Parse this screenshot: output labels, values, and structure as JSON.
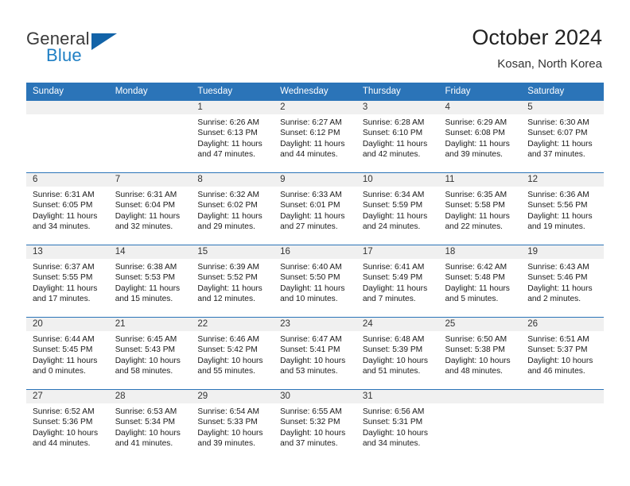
{
  "brand": {
    "word_one": "General",
    "word_two": "Blue",
    "logo_icon": "triangle-logo-icon",
    "accent_color": "#1263a8",
    "blue_text_color": "#1f7fc4"
  },
  "header": {
    "title": "October 2024",
    "subtitle": "Kosan, North Korea"
  },
  "theme": {
    "header_row_bg": "#2b74b8",
    "daynum_bg": "#f0f0f0",
    "row_separator": "#2b74b8"
  },
  "weekday_headers": [
    "Sunday",
    "Monday",
    "Tuesday",
    "Wednesday",
    "Thursday",
    "Friday",
    "Saturday"
  ],
  "weeks": [
    [
      {
        "day": "",
        "blank": true,
        "sunrise": "",
        "sunset": "",
        "daylight_1": "",
        "daylight_2": ""
      },
      {
        "day": "",
        "blank": true,
        "sunrise": "",
        "sunset": "",
        "daylight_1": "",
        "daylight_2": ""
      },
      {
        "day": "1",
        "blank": false,
        "sunrise": "Sunrise: 6:26 AM",
        "sunset": "Sunset: 6:13 PM",
        "daylight_1": "Daylight: 11 hours",
        "daylight_2": "and 47 minutes."
      },
      {
        "day": "2",
        "blank": false,
        "sunrise": "Sunrise: 6:27 AM",
        "sunset": "Sunset: 6:12 PM",
        "daylight_1": "Daylight: 11 hours",
        "daylight_2": "and 44 minutes."
      },
      {
        "day": "3",
        "blank": false,
        "sunrise": "Sunrise: 6:28 AM",
        "sunset": "Sunset: 6:10 PM",
        "daylight_1": "Daylight: 11 hours",
        "daylight_2": "and 42 minutes."
      },
      {
        "day": "4",
        "blank": false,
        "sunrise": "Sunrise: 6:29 AM",
        "sunset": "Sunset: 6:08 PM",
        "daylight_1": "Daylight: 11 hours",
        "daylight_2": "and 39 minutes."
      },
      {
        "day": "5",
        "blank": false,
        "sunrise": "Sunrise: 6:30 AM",
        "sunset": "Sunset: 6:07 PM",
        "daylight_1": "Daylight: 11 hours",
        "daylight_2": "and 37 minutes."
      }
    ],
    [
      {
        "day": "6",
        "blank": false,
        "sunrise": "Sunrise: 6:31 AM",
        "sunset": "Sunset: 6:05 PM",
        "daylight_1": "Daylight: 11 hours",
        "daylight_2": "and 34 minutes."
      },
      {
        "day": "7",
        "blank": false,
        "sunrise": "Sunrise: 6:31 AM",
        "sunset": "Sunset: 6:04 PM",
        "daylight_1": "Daylight: 11 hours",
        "daylight_2": "and 32 minutes."
      },
      {
        "day": "8",
        "blank": false,
        "sunrise": "Sunrise: 6:32 AM",
        "sunset": "Sunset: 6:02 PM",
        "daylight_1": "Daylight: 11 hours",
        "daylight_2": "and 29 minutes."
      },
      {
        "day": "9",
        "blank": false,
        "sunrise": "Sunrise: 6:33 AM",
        "sunset": "Sunset: 6:01 PM",
        "daylight_1": "Daylight: 11 hours",
        "daylight_2": "and 27 minutes."
      },
      {
        "day": "10",
        "blank": false,
        "sunrise": "Sunrise: 6:34 AM",
        "sunset": "Sunset: 5:59 PM",
        "daylight_1": "Daylight: 11 hours",
        "daylight_2": "and 24 minutes."
      },
      {
        "day": "11",
        "blank": false,
        "sunrise": "Sunrise: 6:35 AM",
        "sunset": "Sunset: 5:58 PM",
        "daylight_1": "Daylight: 11 hours",
        "daylight_2": "and 22 minutes."
      },
      {
        "day": "12",
        "blank": false,
        "sunrise": "Sunrise: 6:36 AM",
        "sunset": "Sunset: 5:56 PM",
        "daylight_1": "Daylight: 11 hours",
        "daylight_2": "and 19 minutes."
      }
    ],
    [
      {
        "day": "13",
        "blank": false,
        "sunrise": "Sunrise: 6:37 AM",
        "sunset": "Sunset: 5:55 PM",
        "daylight_1": "Daylight: 11 hours",
        "daylight_2": "and 17 minutes."
      },
      {
        "day": "14",
        "blank": false,
        "sunrise": "Sunrise: 6:38 AM",
        "sunset": "Sunset: 5:53 PM",
        "daylight_1": "Daylight: 11 hours",
        "daylight_2": "and 15 minutes."
      },
      {
        "day": "15",
        "blank": false,
        "sunrise": "Sunrise: 6:39 AM",
        "sunset": "Sunset: 5:52 PM",
        "daylight_1": "Daylight: 11 hours",
        "daylight_2": "and 12 minutes."
      },
      {
        "day": "16",
        "blank": false,
        "sunrise": "Sunrise: 6:40 AM",
        "sunset": "Sunset: 5:50 PM",
        "daylight_1": "Daylight: 11 hours",
        "daylight_2": "and 10 minutes."
      },
      {
        "day": "17",
        "blank": false,
        "sunrise": "Sunrise: 6:41 AM",
        "sunset": "Sunset: 5:49 PM",
        "daylight_1": "Daylight: 11 hours",
        "daylight_2": "and 7 minutes."
      },
      {
        "day": "18",
        "blank": false,
        "sunrise": "Sunrise: 6:42 AM",
        "sunset": "Sunset: 5:48 PM",
        "daylight_1": "Daylight: 11 hours",
        "daylight_2": "and 5 minutes."
      },
      {
        "day": "19",
        "blank": false,
        "sunrise": "Sunrise: 6:43 AM",
        "sunset": "Sunset: 5:46 PM",
        "daylight_1": "Daylight: 11 hours",
        "daylight_2": "and 2 minutes."
      }
    ],
    [
      {
        "day": "20",
        "blank": false,
        "sunrise": "Sunrise: 6:44 AM",
        "sunset": "Sunset: 5:45 PM",
        "daylight_1": "Daylight: 11 hours",
        "daylight_2": "and 0 minutes."
      },
      {
        "day": "21",
        "blank": false,
        "sunrise": "Sunrise: 6:45 AM",
        "sunset": "Sunset: 5:43 PM",
        "daylight_1": "Daylight: 10 hours",
        "daylight_2": "and 58 minutes."
      },
      {
        "day": "22",
        "blank": false,
        "sunrise": "Sunrise: 6:46 AM",
        "sunset": "Sunset: 5:42 PM",
        "daylight_1": "Daylight: 10 hours",
        "daylight_2": "and 55 minutes."
      },
      {
        "day": "23",
        "blank": false,
        "sunrise": "Sunrise: 6:47 AM",
        "sunset": "Sunset: 5:41 PM",
        "daylight_1": "Daylight: 10 hours",
        "daylight_2": "and 53 minutes."
      },
      {
        "day": "24",
        "blank": false,
        "sunrise": "Sunrise: 6:48 AM",
        "sunset": "Sunset: 5:39 PM",
        "daylight_1": "Daylight: 10 hours",
        "daylight_2": "and 51 minutes."
      },
      {
        "day": "25",
        "blank": false,
        "sunrise": "Sunrise: 6:50 AM",
        "sunset": "Sunset: 5:38 PM",
        "daylight_1": "Daylight: 10 hours",
        "daylight_2": "and 48 minutes."
      },
      {
        "day": "26",
        "blank": false,
        "sunrise": "Sunrise: 6:51 AM",
        "sunset": "Sunset: 5:37 PM",
        "daylight_1": "Daylight: 10 hours",
        "daylight_2": "and 46 minutes."
      }
    ],
    [
      {
        "day": "27",
        "blank": false,
        "sunrise": "Sunrise: 6:52 AM",
        "sunset": "Sunset: 5:36 PM",
        "daylight_1": "Daylight: 10 hours",
        "daylight_2": "and 44 minutes."
      },
      {
        "day": "28",
        "blank": false,
        "sunrise": "Sunrise: 6:53 AM",
        "sunset": "Sunset: 5:34 PM",
        "daylight_1": "Daylight: 10 hours",
        "daylight_2": "and 41 minutes."
      },
      {
        "day": "29",
        "blank": false,
        "sunrise": "Sunrise: 6:54 AM",
        "sunset": "Sunset: 5:33 PM",
        "daylight_1": "Daylight: 10 hours",
        "daylight_2": "and 39 minutes."
      },
      {
        "day": "30",
        "blank": false,
        "sunrise": "Sunrise: 6:55 AM",
        "sunset": "Sunset: 5:32 PM",
        "daylight_1": "Daylight: 10 hours",
        "daylight_2": "and 37 minutes."
      },
      {
        "day": "31",
        "blank": false,
        "sunrise": "Sunrise: 6:56 AM",
        "sunset": "Sunset: 5:31 PM",
        "daylight_1": "Daylight: 10 hours",
        "daylight_2": "and 34 minutes."
      },
      {
        "day": "",
        "blank": true,
        "sunrise": "",
        "sunset": "",
        "daylight_1": "",
        "daylight_2": ""
      },
      {
        "day": "",
        "blank": true,
        "sunrise": "",
        "sunset": "",
        "daylight_1": "",
        "daylight_2": ""
      }
    ]
  ]
}
